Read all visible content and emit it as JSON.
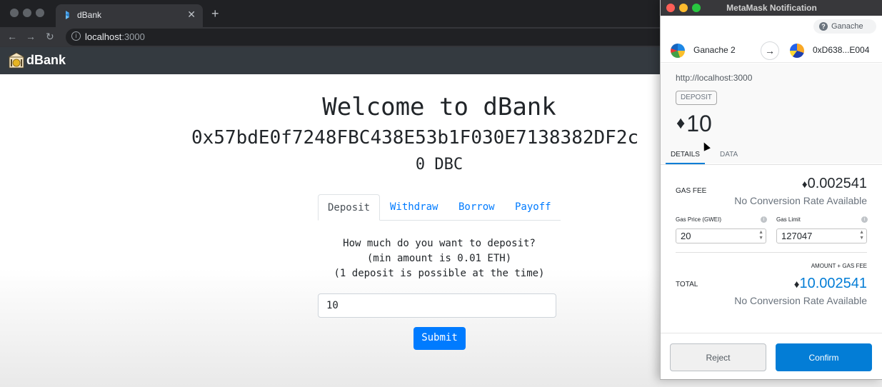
{
  "browser": {
    "tab_title": "dBank",
    "tab_close": "✕",
    "new_tab": "+",
    "back": "←",
    "forward": "→",
    "reload": "↻",
    "url_host": "localhost",
    "url_port": ":3000"
  },
  "navbar": {
    "brand": "dBank"
  },
  "main": {
    "welcome": "Welcome to dBank",
    "address": "0x57bdE0f7248FBC438E53b1F030E7138382DF2c",
    "balance": "0 DBC",
    "tabs": [
      {
        "label": "Deposit"
      },
      {
        "label": "Withdraw"
      },
      {
        "label": "Borrow"
      },
      {
        "label": "Payoff"
      }
    ],
    "prompt_line1": "How much do you want to deposit?",
    "prompt_line2": "(min amount is 0.01 ETH)",
    "prompt_line3": "(1 deposit is possible at the time)",
    "input_value": "10",
    "submit_label": "Submit"
  },
  "metamask": {
    "window_title": "MetaMask Notification",
    "network": "Ganache",
    "network_icon": "?",
    "from_account": "Ganache 2",
    "to_account": "0xD638...E004",
    "origin": "http://localhost:3000",
    "method": "DEPOSIT",
    "eth_symbol": "♦",
    "amount": "10",
    "tabs": {
      "details": "DETAILS",
      "data": "DATA"
    },
    "gas_fee_label": "GAS FEE",
    "gas_fee_value": "0.002541",
    "no_conversion": "No Conversion Rate Available",
    "gas_price_label": "Gas Price (GWEI)",
    "gas_limit_label": "Gas Limit",
    "gas_price_value": "20",
    "gas_limit_value": "127047",
    "amount_plus_gas_label": "AMOUNT + GAS FEE",
    "total_label": "TOTAL",
    "total_value": "10.002541",
    "total_no_conversion": "No Conversion Rate Available",
    "reject_label": "Reject",
    "confirm_label": "Confirm",
    "colors": {
      "accent": "#037dd6",
      "titlebar": "#38383b"
    }
  }
}
